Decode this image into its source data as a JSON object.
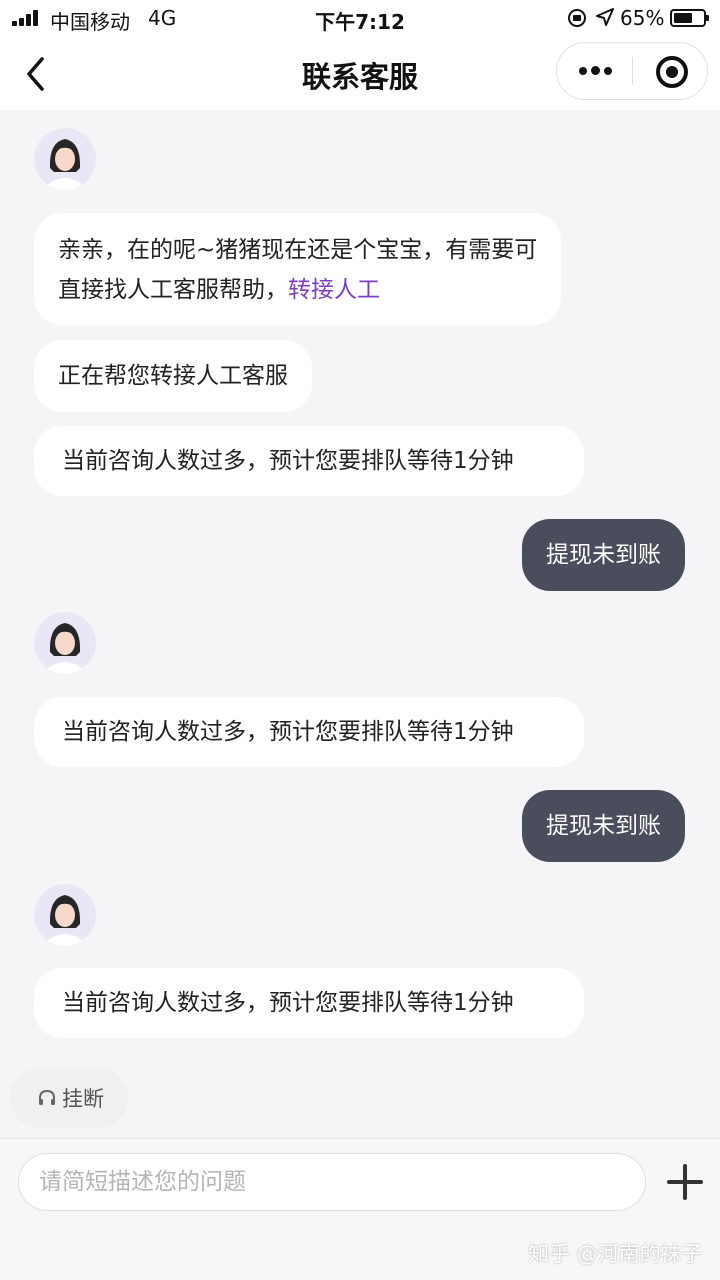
{
  "status_bar": {
    "carrier": "中国移动",
    "network": "4G",
    "time": "下午7:12",
    "battery_percent": "65%",
    "battery_level": 0.65,
    "icons": [
      "signal-icon",
      "rotation-lock-icon",
      "location-icon",
      "battery-icon"
    ]
  },
  "nav": {
    "title": "联系客服",
    "icons": [
      "back-chevron-icon",
      "more-dots-icon",
      "target-close-icon"
    ]
  },
  "messages": [
    {
      "from": "agent",
      "part1": "亲亲，在的呢~猪猪现在还是个宝宝，有需要可",
      "part2": "直接找人工客服帮助，",
      "link": "转接人工"
    },
    {
      "from": "agent",
      "text": "正在帮您转接人工客服"
    },
    {
      "from": "agent",
      "text": "当前咨询人数过多，预计您要排队等待1分钟"
    },
    {
      "from": "user",
      "text": "提现未到账"
    },
    {
      "from": "agent",
      "text": "当前咨询人数过多，预计您要排队等待1分钟"
    },
    {
      "from": "user",
      "text": "提现未到账"
    },
    {
      "from": "agent",
      "text": "当前咨询人数过多，预计您要排队等待1分钟"
    }
  ],
  "hangup": {
    "label": "挂断",
    "icon": "headset-icon"
  },
  "input": {
    "placeholder": "请简短描述您的问题",
    "value": ""
  },
  "add_icon": "plus-icon",
  "watermark": "知乎 @河南的袜子",
  "colors": {
    "user_bubble": "#4a4d5b",
    "agent_bubble": "#ffffff",
    "link": "#7b3fc4",
    "background": "#f5f5f7"
  }
}
